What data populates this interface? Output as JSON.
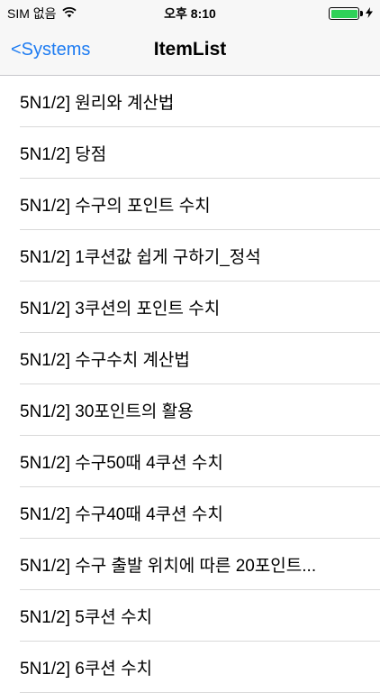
{
  "status_bar": {
    "carrier": "SIM 없음",
    "time": "오후 8:10",
    "battery_level": 1.0,
    "battery_color": "#2fd158"
  },
  "nav": {
    "back_label": "<Systems",
    "title": "ItemList",
    "accent_color": "#1e7cf2"
  },
  "items": [
    "5N1/2] 원리와 계산법",
    "5N1/2] 당점",
    "5N1/2] 수구의 포인트 수치",
    "5N1/2] 1쿠션값 쉽게 구하기_정석",
    "5N1/2] 3쿠션의 포인트 수치",
    "5N1/2] 수구수치 계산법",
    "5N1/2] 30포인트의 활용",
    "5N1/2] 수구50때 4쿠션 수치",
    "5N1/2] 수구40때 4쿠션 수치",
    "5N1/2] 수구 출발 위치에 따른 20포인트...",
    "5N1/2] 5쿠션 수치",
    "5N1/2] 6쿠션 수치"
  ]
}
